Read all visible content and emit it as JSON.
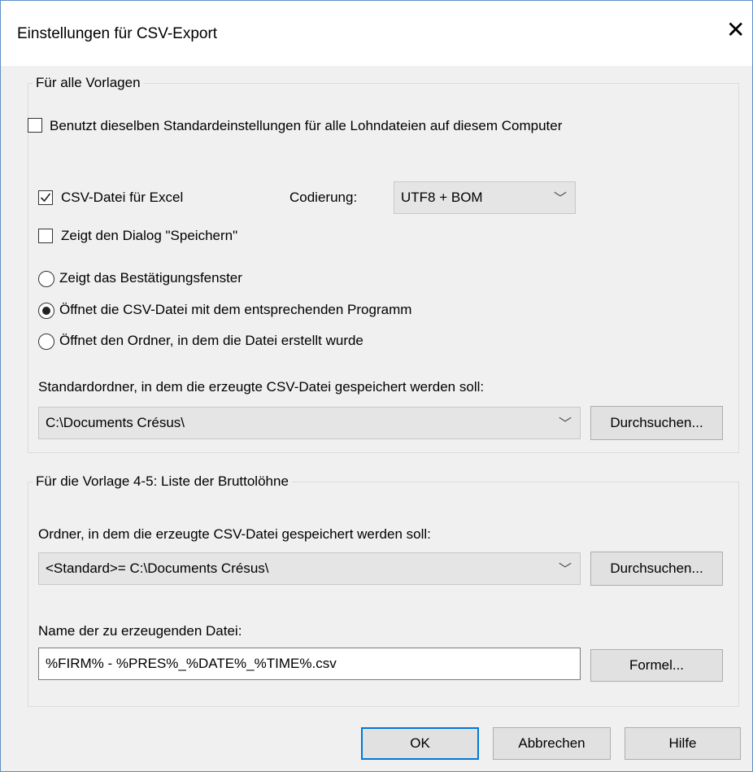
{
  "window": {
    "title": "Einstellungen für CSV-Export",
    "close_icon": "close-icon"
  },
  "group_all": {
    "legend": "Für alle Vorlagen",
    "same_defaults": {
      "label": "Benutzt dieselben Standardeinstellungen für alle Lohndateien auf diesem Computer",
      "checked": false
    },
    "csv_excel": {
      "label": "CSV-Datei für Excel",
      "checked": true
    },
    "encoding_label": "Codierung:",
    "encoding_value": "UTF8 + BOM",
    "show_save_dialog": {
      "label": "Zeigt den Dialog \"Speichern\"",
      "checked": false
    },
    "radio_options": [
      {
        "label": "Zeigt das Bestätigungsfenster",
        "selected": false
      },
      {
        "label": "Öffnet die CSV-Datei mit dem entsprechenden Programm",
        "selected": true
      },
      {
        "label": "Öffnet den Ordner, in dem die Datei erstellt wurde",
        "selected": false
      }
    ],
    "default_folder_label": "Standardordner, in dem die erzeugte CSV-Datei gespeichert werden soll:",
    "default_folder_value": "C:\\Documents Crésus\\",
    "browse_label": "Durchsuchen..."
  },
  "group_template": {
    "legend": "Für die Vorlage 4-5: Liste der Bruttolöhne",
    "folder_label": "Ordner, in dem die erzeugte CSV-Datei gespeichert werden soll:",
    "folder_value": "<Standard>= C:\\Documents Crésus\\",
    "browse_label": "Durchsuchen...",
    "filename_label": "Name der zu erzeugenden Datei:",
    "filename_value": "%FIRM% - %PRES%_%DATE%_%TIME%.csv",
    "formula_label": "Formel..."
  },
  "buttons": {
    "ok": "OK",
    "cancel": "Abbrechen",
    "help": "Hilfe"
  }
}
